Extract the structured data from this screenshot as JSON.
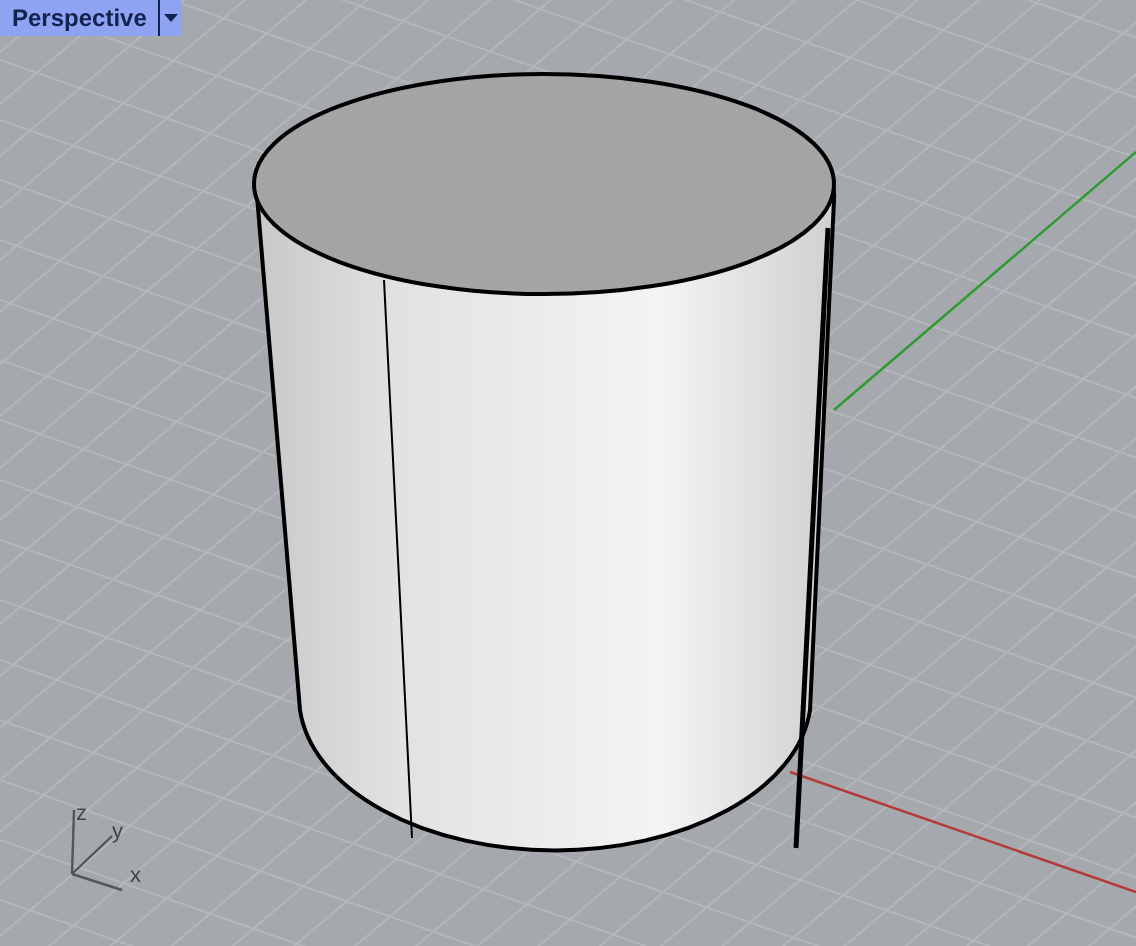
{
  "viewport": {
    "title": "Perspective",
    "axis_labels": [
      "z",
      "y",
      "x"
    ]
  }
}
